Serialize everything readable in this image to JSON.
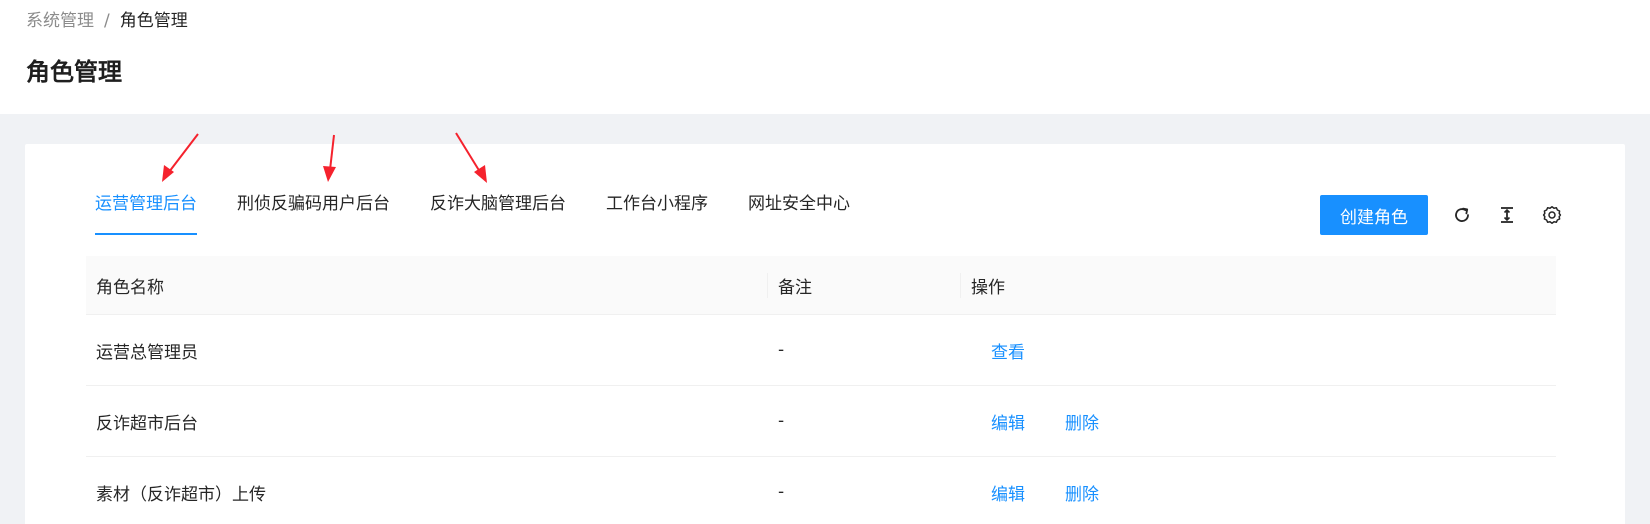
{
  "breadcrumb": {
    "parent": "系统管理",
    "separator": "/",
    "current": "角色管理"
  },
  "page_title": "角色管理",
  "tabs": [
    {
      "label": "运营管理后台",
      "active": true
    },
    {
      "label": "刑侦反骗码用户后台",
      "active": false
    },
    {
      "label": "反诈大脑管理后台",
      "active": false
    },
    {
      "label": "工作台小程序",
      "active": false
    },
    {
      "label": "网址安全中心",
      "active": false
    }
  ],
  "toolbar": {
    "create_label": "创建角色",
    "icons": [
      "refresh-icon",
      "column-height-icon",
      "settings-icon"
    ]
  },
  "table": {
    "columns": [
      "角色名称",
      "备注",
      "操作"
    ],
    "rows": [
      {
        "name": "运营总管理员",
        "note": "-",
        "actions": [
          "查看"
        ]
      },
      {
        "name": "反诈超市后台",
        "note": "-",
        "actions": [
          "编辑",
          "删除"
        ]
      },
      {
        "name": "素材（反诈超市）上传",
        "note": "-",
        "actions": [
          "编辑",
          "删除"
        ]
      }
    ]
  },
  "colors": {
    "accent": "#1890ff",
    "annotation_arrow": "#f5222d"
  }
}
